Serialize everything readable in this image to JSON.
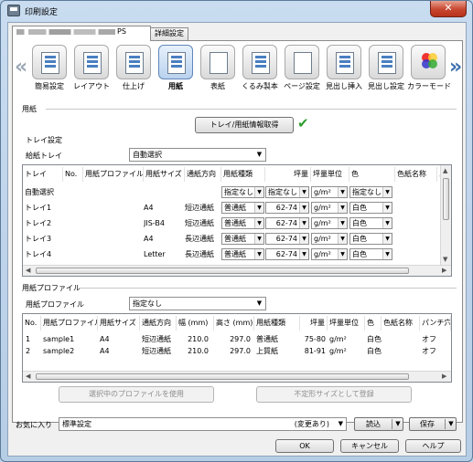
{
  "window": {
    "title": "印刷設定",
    "close_glyph": "✕"
  },
  "tabs": [
    {
      "label": "PS",
      "active": true
    },
    {
      "label": "詳細設定",
      "active": false
    }
  ],
  "toolbar": {
    "items": [
      {
        "label": "簡易設定",
        "icon": "quick-setup-icon"
      },
      {
        "label": "レイアウト",
        "icon": "layout-icon"
      },
      {
        "label": "仕上げ",
        "icon": "finishing-icon"
      },
      {
        "label": "用紙",
        "icon": "paper-icon",
        "selected": true
      },
      {
        "label": "表紙",
        "icon": "cover-icon"
      },
      {
        "label": "くるみ製本",
        "icon": "perfect-binding-icon"
      },
      {
        "label": "ページ設定",
        "icon": "page-setting-icon"
      },
      {
        "label": "見出し挿入",
        "icon": "tab-insert-icon"
      },
      {
        "label": "見出し設定",
        "icon": "tab-setting-icon"
      },
      {
        "label": "カラーモード",
        "icon": "color-mode-icon"
      }
    ]
  },
  "paper_section": {
    "title": "用紙",
    "get_info_button": "トレイ/用紙情報取得",
    "tray_settings_title": "トレイ設定",
    "feed_tray_label": "給紙トレイ",
    "feed_tray_value": "自動選択"
  },
  "tray_table": {
    "headers": [
      "トレイ",
      "No.",
      "用紙プロファイル",
      "用紙サイズ",
      "通紙方向",
      "用紙種類",
      "坪量",
      "坪量単位",
      "色",
      "色紙名称",
      "パ"
    ],
    "rows": [
      {
        "tray": "自動選択",
        "no": "",
        "profile": "",
        "size": "",
        "dir": "",
        "type": "指定なし",
        "weight": "指定なし",
        "unit": "g/m²",
        "color": "指定なし"
      },
      {
        "tray": "トレイ1",
        "no": "",
        "profile": "",
        "size": "A4",
        "dir": "短辺通紙",
        "type": "普通紙",
        "weight": "62-74",
        "unit": "g/m²",
        "color": "白色"
      },
      {
        "tray": "トレイ2",
        "no": "",
        "profile": "",
        "size": "JIS-B4",
        "dir": "短辺通紙",
        "type": "普通紙",
        "weight": "62-74",
        "unit": "g/m²",
        "color": "白色"
      },
      {
        "tray": "トレイ3",
        "no": "",
        "profile": "",
        "size": "A4",
        "dir": "長辺通紙",
        "type": "普通紙",
        "weight": "62-74",
        "unit": "g/m²",
        "color": "白色"
      },
      {
        "tray": "トレイ4",
        "no": "",
        "profile": "",
        "size": "Letter",
        "dir": "長辺通紙",
        "type": "普通紙",
        "weight": "62-74",
        "unit": "g/m²",
        "color": "白色"
      }
    ]
  },
  "profile_section": {
    "title": "用紙プロファイル",
    "profile_label": "用紙プロファイル",
    "profile_value": "指定なし"
  },
  "profile_table": {
    "headers": [
      "No.",
      "用紙プロファイル",
      "用紙サイズ",
      "通紙方向",
      "幅 (mm)",
      "高さ (mm)",
      "用紙種類",
      "坪量",
      "坪量単位",
      "色",
      "色紙名称",
      "パンチ穴あ"
    ],
    "rows": [
      {
        "no": "1",
        "profile": "sample1",
        "size": "A4",
        "dir": "短辺通紙",
        "width": "210.0",
        "height": "297.0",
        "type": "普通紙",
        "weight": "75-80",
        "unit": "g/m²",
        "color": "白色",
        "colorname": "",
        "punch": "オフ"
      },
      {
        "no": "2",
        "profile": "sample2",
        "size": "A4",
        "dir": "短辺通紙",
        "width": "210.0",
        "height": "297.0",
        "type": "上質紙",
        "weight": "81-91",
        "unit": "g/m²",
        "color": "白色",
        "colorname": "",
        "punch": "オフ"
      }
    ]
  },
  "profile_buttons": {
    "use_selected": "選択中のプロファイルを使用",
    "register_custom": "不定形サイズとして登録"
  },
  "favorites": {
    "label": "お気に入り",
    "value": "標準設定",
    "modified": "(変更あり)",
    "load": "読込",
    "save": "保存"
  },
  "dialog_buttons": {
    "ok": "OK",
    "cancel": "キャンセル",
    "help": "ヘルプ"
  },
  "colors": {
    "accent": "#3b6fae",
    "check": "#2f9e2f",
    "close": "#c7452e"
  }
}
